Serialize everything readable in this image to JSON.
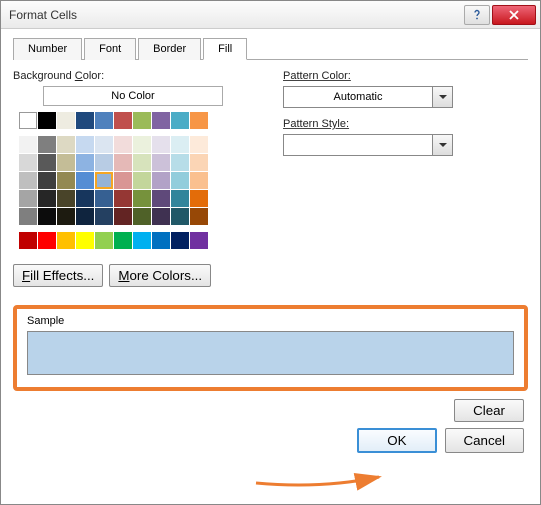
{
  "title": "Format Cells",
  "tabs": {
    "number": "Number",
    "font": "Font",
    "border": "Border",
    "fill": "Fill"
  },
  "left": {
    "bg_label": "Background",
    "bg_label2": "olor:",
    "nocolor": "No Color",
    "fill_effects": "ill Effects...",
    "more_colors": "ore Colors..."
  },
  "right": {
    "pattern_color_label": "Pattern Color:",
    "pattern_color_value": "Automatic",
    "pattern_style_label": "Pattern Style:",
    "pattern_style_value": ""
  },
  "sample": {
    "label": "Sample",
    "color": "#b9d3ea"
  },
  "buttons": {
    "clear": "Clear",
    "ok": "OK",
    "cancel": "Cancel"
  },
  "palette": {
    "theme": [
      [
        "#ffffff",
        "#000000",
        "#eeece1",
        "#1f497d",
        "#4f81bd",
        "#c0504d",
        "#9bbb59",
        "#8064a2",
        "#4bacc6",
        "#f79646"
      ],
      [
        "#f2f2f2",
        "#7f7f7f",
        "#ddd9c3",
        "#c6d9f0",
        "#dbe5f1",
        "#f2dcdb",
        "#ebf1dd",
        "#e5e0ec",
        "#dbeef3",
        "#fdeada"
      ],
      [
        "#d8d8d8",
        "#595959",
        "#c4bd97",
        "#8db3e2",
        "#b8cce4",
        "#e5b9b7",
        "#d7e3bc",
        "#ccc1d9",
        "#b7dde8",
        "#fbd5b5"
      ],
      [
        "#bfbfbf",
        "#3f3f3f",
        "#938953",
        "#548dd4",
        "#95b3d7",
        "#d99694",
        "#c3d69b",
        "#b2a2c7",
        "#92cddc",
        "#fac08f"
      ],
      [
        "#a5a5a5",
        "#262626",
        "#494429",
        "#17365d",
        "#366092",
        "#953734",
        "#76923c",
        "#5f497a",
        "#31859b",
        "#e36c09"
      ],
      [
        "#7f7f7f",
        "#0c0c0c",
        "#1d1b10",
        "#0f243e",
        "#244061",
        "#632423",
        "#4f6128",
        "#3f3151",
        "#205867",
        "#974806"
      ]
    ],
    "standard": [
      "#c00000",
      "#ff0000",
      "#ffc000",
      "#ffff00",
      "#92d050",
      "#00b050",
      "#00b0f0",
      "#0070c0",
      "#002060",
      "#7030a0"
    ]
  }
}
